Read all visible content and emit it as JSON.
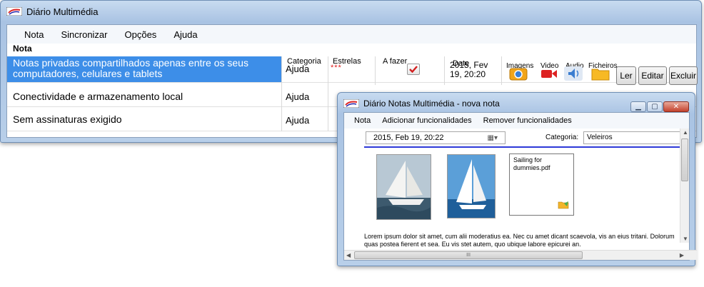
{
  "main_window": {
    "title": "Diário Multimédia",
    "menu": [
      "Nota",
      "Sincronizar",
      "Opções",
      "Ajuda"
    ],
    "columns": {
      "nota": "Nota",
      "categoria": "Categoria",
      "estrelas": "Estrelas",
      "afazer": "A fazer",
      "date": "Date",
      "imagens": "Imagens",
      "video": "Video",
      "audio": "Audio",
      "ficheiros": "Ficheiros"
    },
    "rows": [
      {
        "nota": "Notas privadas compartilhados apenas entre os seus computadores, celulares e tablets",
        "categoria": "Ajuda",
        "estrelas": "***",
        "date": "2015, Fev 19, 20:20",
        "selected": true
      },
      {
        "nota": "Conectividade e armazenamento local",
        "categoria": "Ajuda"
      },
      {
        "nota": "Sem assinaturas exigido",
        "categoria": "Ajuda"
      }
    ],
    "buttons": {
      "ler": "Ler",
      "editar": "Editar",
      "excluir": "Excluir"
    }
  },
  "note_window": {
    "title": "Diário Notas Multimédia - nova nota",
    "menu": [
      "Nota",
      "Adicionar funcionalidades",
      "Remover funcionalidades"
    ],
    "date_value": "2015, Feb 19, 20:22",
    "categoria_label": "Categoria:",
    "categoria_value": "Veleiros",
    "file_name": "Sailing for dummies.pdf",
    "body_text": "Lorem ipsum dolor sit amet, cum alii moderatius ea. Nec cu amet dicant scaevola, vis an eius tritani. Dolorum quas postea fierent et sea. Eu vis stet autem, quo ubique labore epicurei an.",
    "hscroll_grip": "III"
  },
  "colors": {
    "selection": "#3d8ee8",
    "accent_line": "#2d39d8",
    "stars": "#e02020"
  }
}
